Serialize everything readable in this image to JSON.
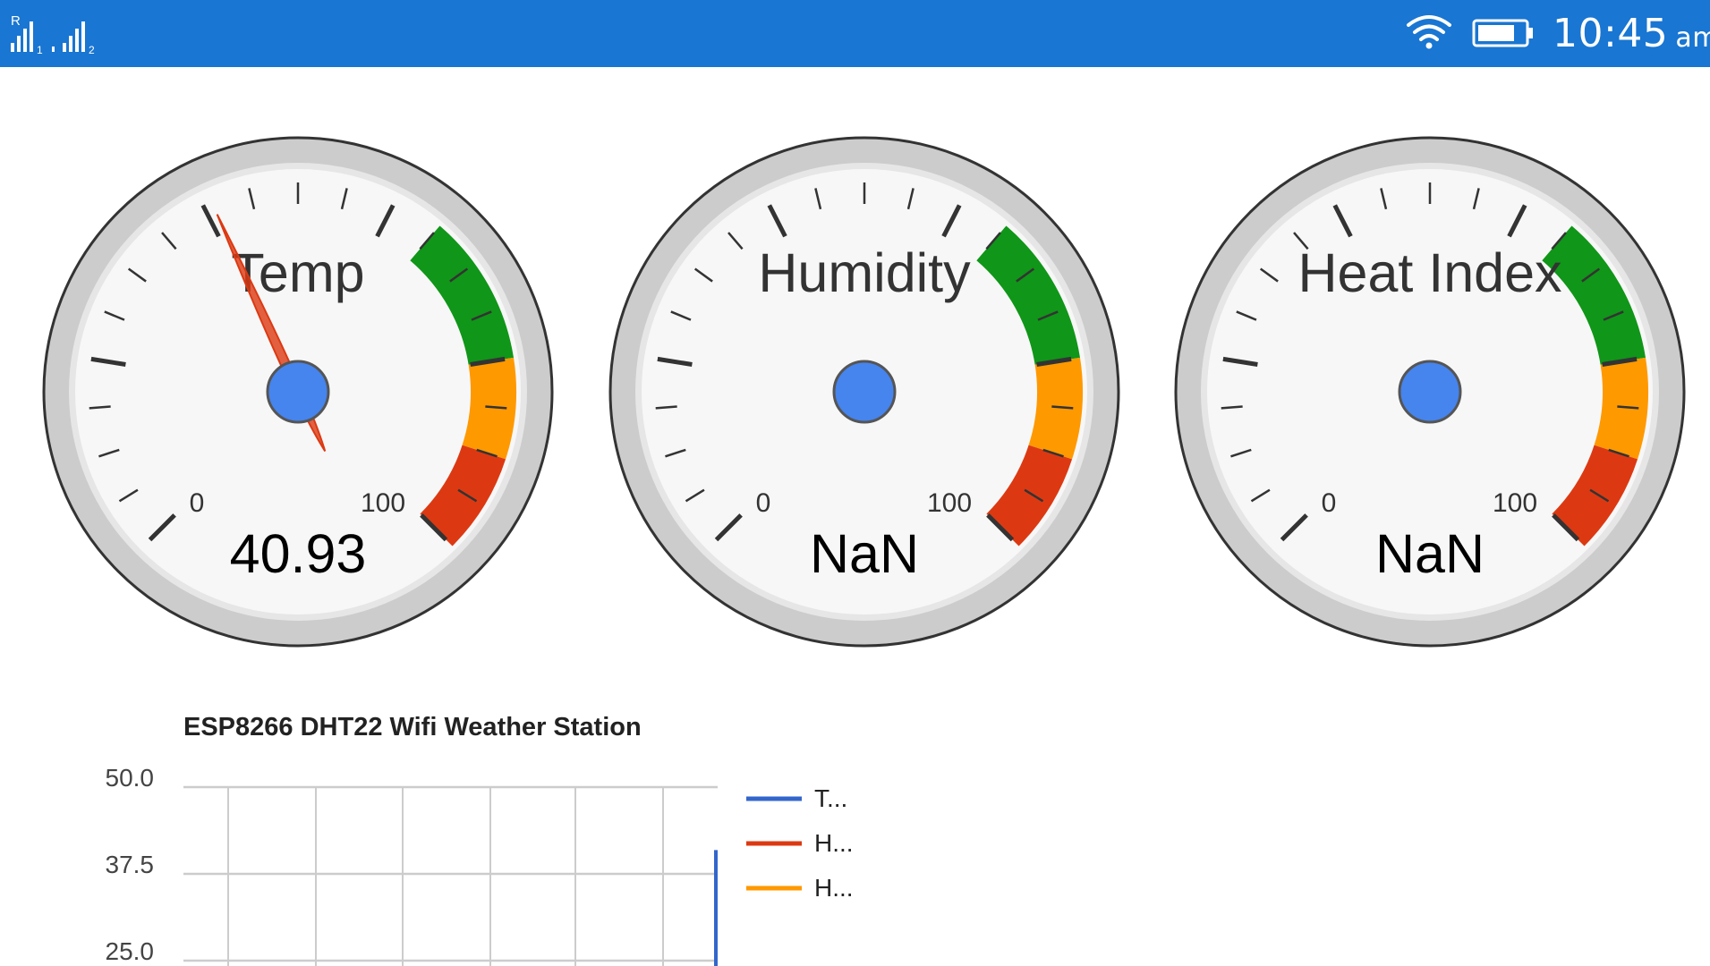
{
  "status_bar": {
    "signal_icon": "dual-sim-signal-icon",
    "wifi_icon": "wifi-icon",
    "battery_icon": "battery-icon",
    "time": "10:45",
    "ampm": "am",
    "background": "#1976d2"
  },
  "gauges": [
    {
      "label": "Temp",
      "value_text": "40.93",
      "value": 40.93,
      "min_label": "0",
      "max_label": "100",
      "min": 0,
      "max": 100,
      "show_needle": true
    },
    {
      "label": "Humidity",
      "value_text": "NaN",
      "value": null,
      "min_label": "0",
      "max_label": "100",
      "min": 0,
      "max": 100,
      "show_needle": false
    },
    {
      "label": "Heat Index",
      "value_text": "NaN",
      "value": null,
      "min_label": "0",
      "max_label": "100",
      "min": 0,
      "max": 100,
      "show_needle": false
    }
  ],
  "gauge_bands": [
    {
      "from": 65,
      "to": 80,
      "color": "#109618"
    },
    {
      "from": 80,
      "to": 90,
      "color": "#ff9900"
    },
    {
      "from": 90,
      "to": 100,
      "color": "#dc3912"
    }
  ],
  "gauge_colors": {
    "needle": "#dc3912",
    "hub": "#4684ee",
    "face": "#f7f7f7",
    "rim": "#cccccc"
  },
  "chart_data": {
    "type": "line",
    "title": "ESP8266 DHT22 Wifi Weather Station",
    "y_ticks": [
      "50.0",
      "37.5",
      "25.0"
    ],
    "y_tick_values": [
      50.0,
      37.5,
      25.0
    ],
    "ylim": [
      25.0,
      50.0
    ],
    "grid": true,
    "legend_position": "right",
    "series": [
      {
        "name": "T...",
        "color": "#3366cc",
        "values": [
          40.93
        ]
      },
      {
        "name": "H...",
        "color": "#dc3912",
        "values": []
      },
      {
        "name": "H...",
        "color": "#ff9900",
        "values": []
      }
    ]
  }
}
